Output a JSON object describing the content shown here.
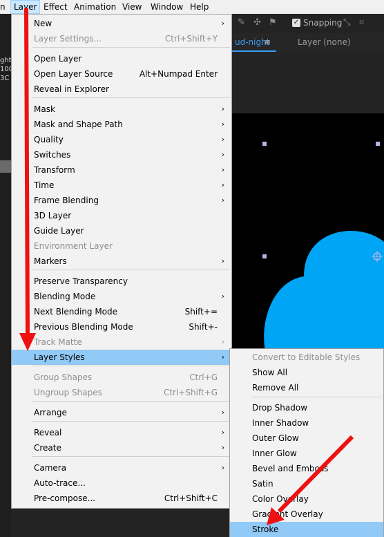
{
  "menubar": {
    "items": [
      {
        "label": "n",
        "active": false
      },
      {
        "label": "Layer",
        "active": true
      },
      {
        "label": "Effect",
        "active": false
      },
      {
        "label": "Animation",
        "active": false
      },
      {
        "label": "View",
        "active": false
      },
      {
        "label": "Window",
        "active": false
      },
      {
        "label": "Help",
        "active": false
      }
    ]
  },
  "toolbar": {
    "snapping_label": "Snapping",
    "snapping_checked": true
  },
  "composition": {
    "tab_label": "ud-night",
    "tab_menu": "≡",
    "layer_label": "Layer (none)"
  },
  "left_panel": {
    "fragments": [
      "ght",
      "100",
      "3C"
    ]
  },
  "layer_menu": {
    "items": [
      {
        "label": "New",
        "submenu": true
      },
      {
        "label": "Layer Settings...",
        "shortcut": "Ctrl+Shift+Y",
        "disabled": true
      },
      {
        "label": "Open Layer"
      },
      {
        "label": "Open Layer Source",
        "shortcut": "Alt+Numpad Enter"
      },
      {
        "label": "Reveal in Explorer"
      },
      {
        "label": "Mask",
        "submenu": true
      },
      {
        "label": "Mask and Shape Path",
        "submenu": true
      },
      {
        "label": "Quality",
        "submenu": true
      },
      {
        "label": "Switches",
        "submenu": true
      },
      {
        "label": "Transform",
        "submenu": true
      },
      {
        "label": "Time",
        "submenu": true
      },
      {
        "label": "Frame Blending",
        "submenu": true
      },
      {
        "label": "3D Layer"
      },
      {
        "label": "Guide Layer"
      },
      {
        "label": "Environment Layer",
        "disabled": true
      },
      {
        "label": "Markers",
        "submenu": true
      },
      {
        "label": "Preserve Transparency"
      },
      {
        "label": "Blending Mode",
        "submenu": true
      },
      {
        "label": "Next Blending Mode",
        "shortcut": "Shift+="
      },
      {
        "label": "Previous Blending Mode",
        "shortcut": "Shift+-"
      },
      {
        "label": "Track Matte",
        "submenu": true,
        "disabled": true
      },
      {
        "label": "Layer Styles",
        "submenu": true,
        "highlighted": true
      },
      {
        "label": "Group Shapes",
        "shortcut": "Ctrl+G",
        "disabled": true
      },
      {
        "label": "Ungroup Shapes",
        "shortcut": "Ctrl+Shift+G",
        "disabled": true
      },
      {
        "label": "Arrange",
        "submenu": true
      },
      {
        "label": "Reveal",
        "submenu": true
      },
      {
        "label": "Create",
        "submenu": true
      },
      {
        "label": "Camera",
        "submenu": true
      },
      {
        "label": "Auto-trace..."
      },
      {
        "label": "Pre-compose...",
        "shortcut": "Ctrl+Shift+C"
      }
    ]
  },
  "layer_styles_submenu": {
    "items": [
      {
        "label": "Convert to Editable Styles",
        "disabled": true
      },
      {
        "label": "Show All"
      },
      {
        "label": "Remove All"
      },
      {
        "label": "Drop Shadow"
      },
      {
        "label": "Inner Shadow"
      },
      {
        "label": "Outer Glow"
      },
      {
        "label": "Inner Glow"
      },
      {
        "label": "Bevel and Emboss"
      },
      {
        "label": "Satin"
      },
      {
        "label": "Color Overlay"
      },
      {
        "label": "Gradient Overlay"
      },
      {
        "label": "Stroke",
        "highlighted": true
      }
    ]
  },
  "colors": {
    "menu_bg": "#f2f2f2",
    "highlight": "#91c9f7",
    "disabled_text": "#8e8e8e",
    "cloud": "#00a5f5",
    "annotation_arrow": "#ee1111",
    "viewer_bg": "#000000"
  }
}
